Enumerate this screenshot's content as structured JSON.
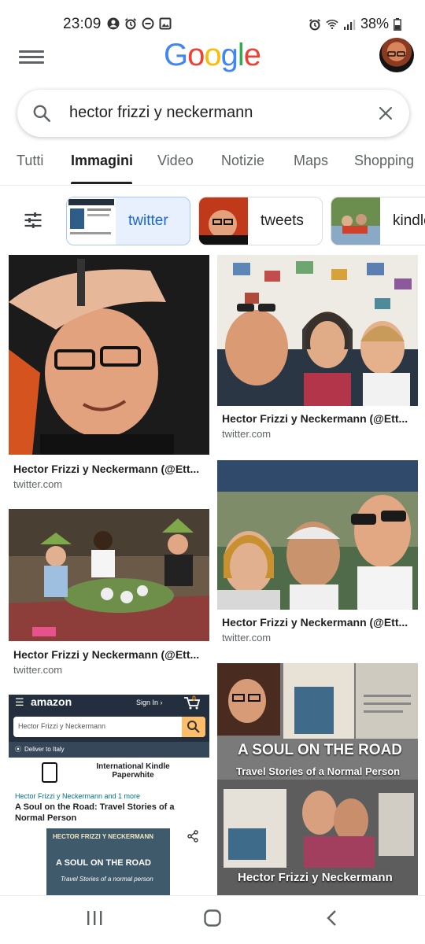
{
  "status_bar": {
    "time": "23:09",
    "battery": "38%",
    "left_icons": [
      "account-circle-icon",
      "alarm-icon",
      "do-not-disturb-icon",
      "image-icon"
    ],
    "right_icons": [
      "alarm-icon",
      "wifi-icon",
      "signal-icon",
      "battery-icon"
    ]
  },
  "header": {
    "logo": [
      "G",
      "o",
      "o",
      "g",
      "l",
      "e"
    ],
    "logo_colors": [
      "#4285F4",
      "#EA4335",
      "#FBBC05",
      "#4285F4",
      "#34A853",
      "#EA4335"
    ]
  },
  "search": {
    "query": "hector frizzi y neckermann"
  },
  "tabs": [
    {
      "label": "Tutti",
      "active": false
    },
    {
      "label": "Immagini",
      "active": true
    },
    {
      "label": "Video",
      "active": false
    },
    {
      "label": "Notizie",
      "active": false
    },
    {
      "label": "Maps",
      "active": false
    },
    {
      "label": "Shopping",
      "active": false
    }
  ],
  "chips": [
    {
      "label": "twitter",
      "active": true
    },
    {
      "label": "tweets",
      "active": false
    },
    {
      "label": "kindle",
      "active": false
    }
  ],
  "results": [
    {
      "title": "Hector Frizzi y Neckermann (@Ett...",
      "source": "twitter.com"
    },
    {
      "title": "Hector Frizzi y Neckermann (@Ett...",
      "source": "twitter.com"
    },
    {
      "title": "Hector Frizzi y Neckermann (@Ett...",
      "source": "twitter.com"
    },
    {
      "title": "Hector Frizzi y Neckermann (@Ett...",
      "source": "twitter.com"
    }
  ],
  "amazon_card": {
    "brand": "amazon",
    "sign_in": "Sign In ›",
    "cart_count": "0",
    "search_value": "Hector Frizzi y Neckermann",
    "deliver": "Deliver to Italy",
    "promo": "International Kindle Paperwhite",
    "author_line": "Hector Frizzi y Neckermann and 1 more",
    "book_title": "A Soul on the Road: Travel Stories of a Normal Person",
    "cover_author": "HECTOR FRIZZI Y NECKERMANN",
    "cover_title": "A SOUL ON THE ROAD",
    "cover_subtitle": "Travel Stories of a normal person"
  },
  "book_card": {
    "title": "A SOUL ON THE ROAD",
    "subtitle": "Travel Stories of a Normal Person",
    "author": "Hector Frizzi y Neckermann"
  },
  "nav_bar": [
    "recent-apps-icon",
    "home-icon",
    "back-icon"
  ]
}
